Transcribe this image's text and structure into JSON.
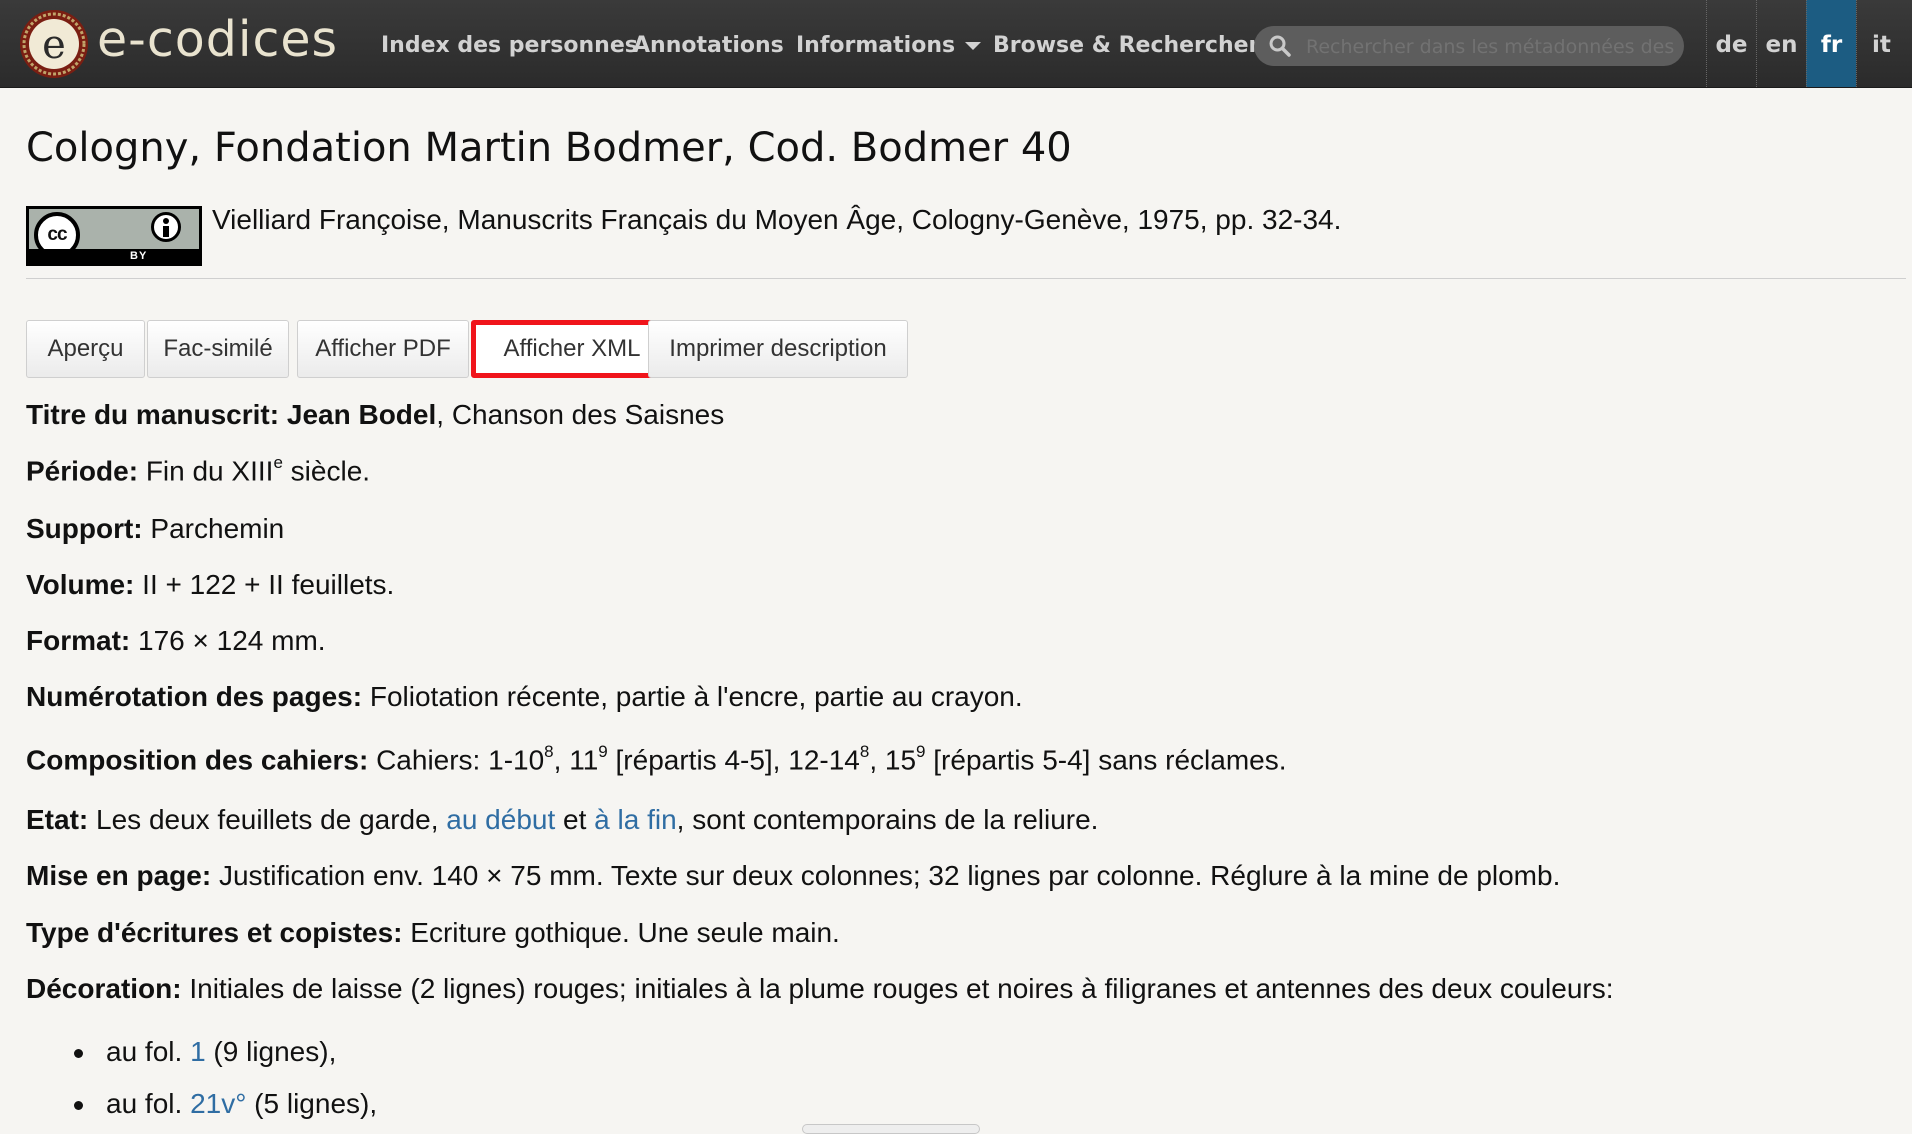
{
  "brand": {
    "name": "e-codices"
  },
  "nav": {
    "items": [
      "Index des personnes",
      "Annotations",
      "Informations",
      "Browse & Rechercher"
    ],
    "search_placeholder": "Rechercher dans les métadonnées des manuscrits"
  },
  "languages": {
    "items": [
      "de",
      "en",
      "fr",
      "it"
    ],
    "active": "fr"
  },
  "colors": {
    "navbar": "#2f2f2f",
    "active_lang": "#1c5c82",
    "link": "#2f6da3",
    "highlight_border": "#f0141b"
  },
  "page": {
    "title": "Cologny, Fondation Martin Bodmer, Cod. Bodmer 40",
    "license": {
      "cc": "cc",
      "by": "BY"
    },
    "citation": "Vielliard Françoise, Manuscrits Français du Moyen Âge, Cologny-Genève, 1975, pp. 32-34."
  },
  "tabs": [
    "Aperçu",
    "Fac-similé",
    "Afficher PDF",
    "Afficher XML",
    "Imprimer description"
  ],
  "highlighted_tab": "Afficher XML",
  "description": {
    "titre": {
      "label": "Titre du manuscrit:",
      "author": "Jean Bodel",
      "text": ", Chanson des Saisnes"
    },
    "periode": {
      "label": "Période:",
      "text_a": "Fin du XIII",
      "sup": "e",
      "text_b": " siècle."
    },
    "support": {
      "label": "Support:",
      "text": "Parchemin"
    },
    "volume": {
      "label": "Volume:",
      "text": "II + 122 + II feuillets."
    },
    "format": {
      "label": "Format:",
      "text": "176 × 124 mm."
    },
    "numerotation": {
      "label": "Numérotation des pages:",
      "text": "Foliotation récente, partie à l'encre, partie au crayon."
    },
    "composition": {
      "label": "Composition des cahiers:",
      "t1": "Cahiers: 1-10",
      "s1": "8",
      "t2": ", 11",
      "s2": "9",
      "t3": " [répartis 4-5], 12-14",
      "s3": "8",
      "t4": ", 15",
      "s4": "9",
      "t5": " [répartis 5-4] sans réclames."
    },
    "etat": {
      "label": "Etat:",
      "t1": "Les deux feuillets de garde, ",
      "l1": "au début",
      "t2": " et ",
      "l2": "à la fin",
      "t3": ", sont contemporains de la reliure."
    },
    "mise": {
      "label": "Mise en page:",
      "text": "Justification env. 140 × 75 mm. Texte sur deux colonnes; 32 lignes par colonne. Réglure à la mine de plomb."
    },
    "ecriture": {
      "label": "Type d'écritures et copistes:",
      "text": "Ecriture gothique. Une seule main."
    },
    "decoration": {
      "label": "Décoration:",
      "text": "Initiales de laisse (2 lignes) rouges; initiales à la plume rouges et noires à filigranes et antennes des deux couleurs:",
      "items": [
        {
          "pre": "au fol. ",
          "link": "1",
          "post": " (9 lignes),"
        },
        {
          "pre": "au fol. ",
          "link": "21v°",
          "post": " (5 lignes),"
        }
      ]
    }
  }
}
